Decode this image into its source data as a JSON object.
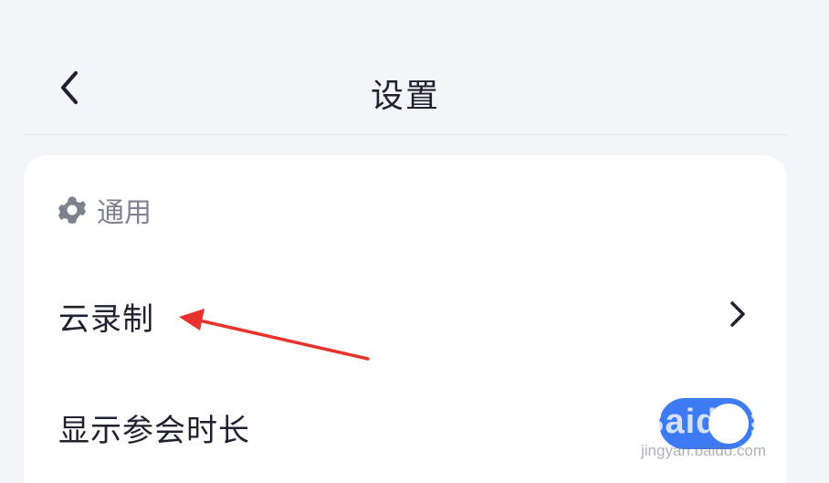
{
  "header": {
    "title": "设置",
    "back_icon": "chevron-left-icon"
  },
  "section": {
    "icon": "gear-icon",
    "label": "通用"
  },
  "rows": [
    {
      "label": "云录制",
      "accessory": "chevron-right-icon"
    },
    {
      "label": "显示参会时长",
      "accessory": "toggle",
      "toggle_on": true
    }
  ],
  "watermark": {
    "brand": "Baidu 经验",
    "domain": "jingyan.baidu.com"
  },
  "colors": {
    "background": "#f4f5f9",
    "card": "#ffffff",
    "accent": "#3d7bf5",
    "annotation_arrow": "#e8322b"
  }
}
